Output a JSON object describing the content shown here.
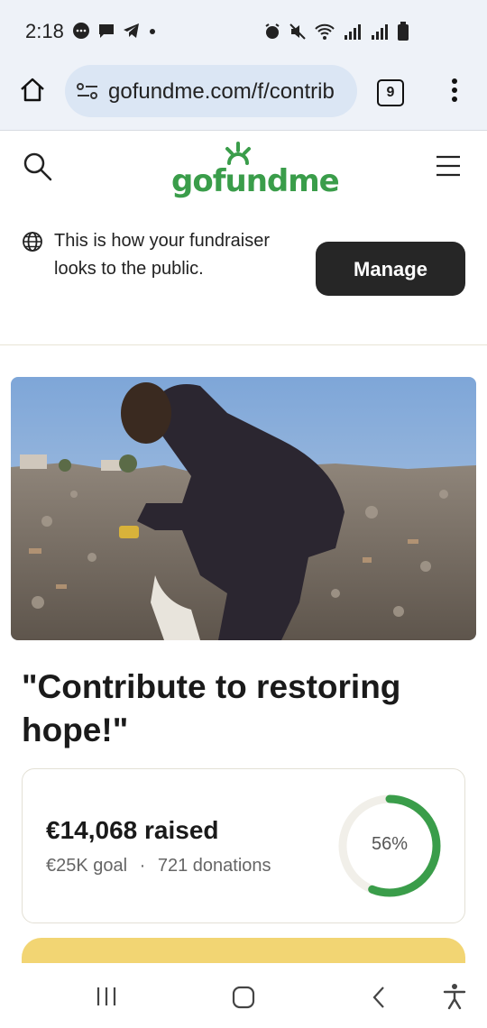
{
  "status": {
    "time": "2:18",
    "left_icons": [
      "chat-bubble-icon",
      "message-icon",
      "telegram-icon",
      "dot-icon"
    ],
    "right_icons": [
      "alarm-icon",
      "mute-icon",
      "wifi-icon",
      "signal-icon",
      "signal-icon",
      "battery-icon"
    ]
  },
  "browser": {
    "url": "gofundme.com/f/contrib",
    "tab_count": "9"
  },
  "header": {
    "logo": "gofundme"
  },
  "notice": {
    "text": "This is how your fundraiser looks to the public.",
    "button": "Manage"
  },
  "campaign": {
    "title": "\"Contribute to restoring hope!\"",
    "raised": "€14,068 raised",
    "goal": "€25K goal",
    "separator": "·",
    "donations": "721 donations",
    "progress_label": "56%",
    "progress": 0.56
  },
  "colors": {
    "brand_green": "#3a9d4a",
    "dark_button": "#262626",
    "ring_track": "#f1efe9",
    "donate_yellow": "#f2d573"
  }
}
